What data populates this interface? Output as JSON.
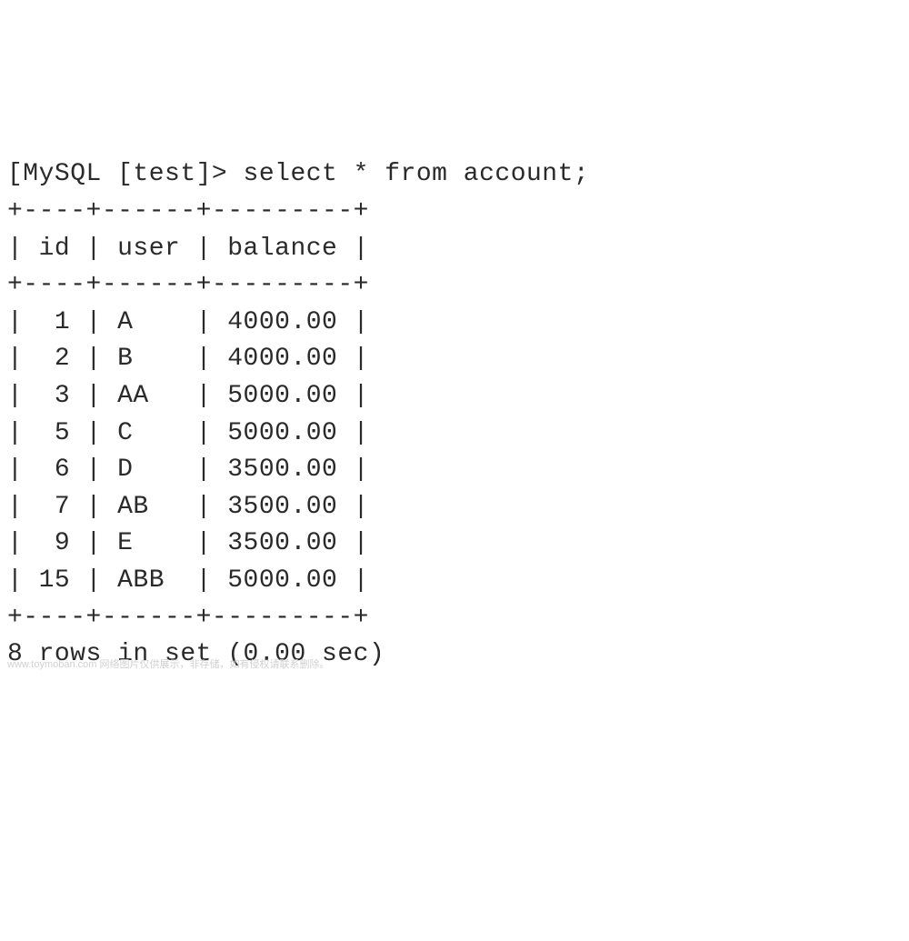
{
  "prompt": "[MySQL [test]> select * from account;",
  "table": {
    "border": "+----+------+---------+",
    "header": "| id | user | balance |",
    "rows": [
      "|  1 | A    | 4000.00 |",
      "|  2 | B    | 4000.00 |",
      "|  3 | AA   | 5000.00 |",
      "|  5 | C    | 5000.00 |",
      "|  6 | D    | 3500.00 |",
      "|  7 | AB   | 3500.00 |",
      "|  9 | E    | 3500.00 |",
      "| 15 | ABB  | 5000.00 |"
    ]
  },
  "footer": "8 rows in set (0.00 sec)",
  "watermark": "www.toymoban.com  网络图片仅供展示，非存储，如有侵权请联系删除。",
  "chart_data": {
    "type": "table",
    "columns": [
      "id",
      "user",
      "balance"
    ],
    "rows": [
      {
        "id": 1,
        "user": "A",
        "balance": 4000.0
      },
      {
        "id": 2,
        "user": "B",
        "balance": 4000.0
      },
      {
        "id": 3,
        "user": "AA",
        "balance": 5000.0
      },
      {
        "id": 5,
        "user": "C",
        "balance": 5000.0
      },
      {
        "id": 6,
        "user": "D",
        "balance": 3500.0
      },
      {
        "id": 7,
        "user": "AB",
        "balance": 3500.0
      },
      {
        "id": 9,
        "user": "E",
        "balance": 3500.0
      },
      {
        "id": 15,
        "user": "ABB",
        "balance": 5000.0
      }
    ],
    "row_count": 8,
    "query_time_sec": 0.0
  }
}
